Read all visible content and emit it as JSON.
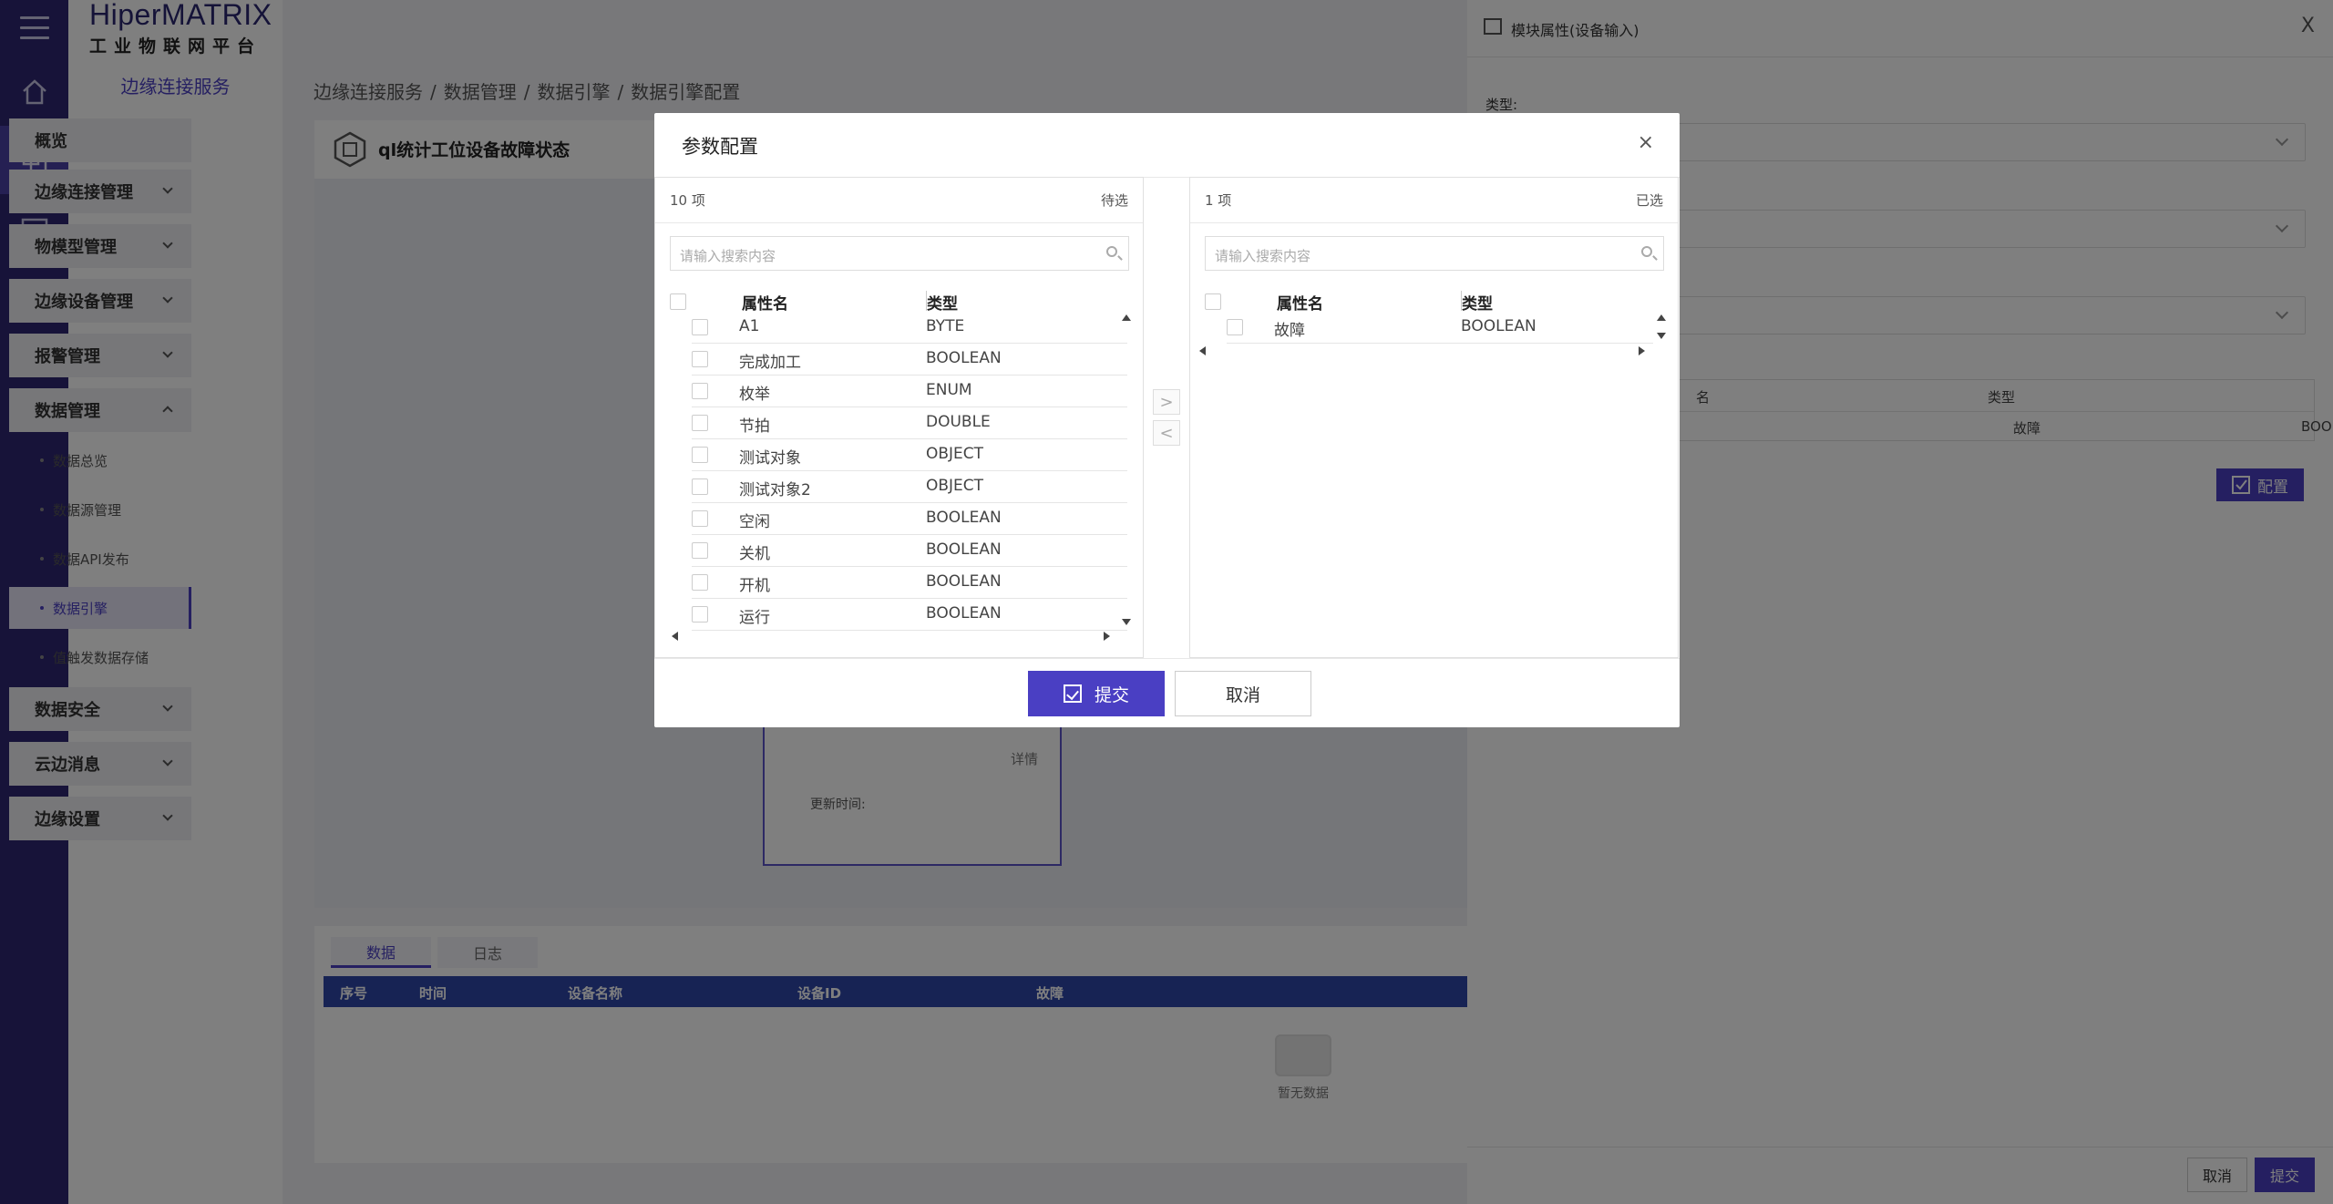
{
  "brand": {
    "logo_main": "HiperMATRIX",
    "logo_sub": "工业物联网平台"
  },
  "sidebar": {
    "title": "边缘连接服务",
    "items": [
      {
        "label": "概览"
      },
      {
        "label": "边缘连接管理"
      },
      {
        "label": "物模型管理"
      },
      {
        "label": "边缘设备管理"
      },
      {
        "label": "报警管理"
      },
      {
        "label": "数据管理"
      },
      {
        "label": "数据安全"
      },
      {
        "label": "云边消息"
      },
      {
        "label": "边缘设置"
      }
    ],
    "sub_items": [
      {
        "label": "数据总览"
      },
      {
        "label": "数据源管理"
      },
      {
        "label": "数据API发布"
      },
      {
        "label": "数据引擎"
      },
      {
        "label": "值触发数据存储"
      }
    ]
  },
  "breadcrumb": [
    "边缘连接服务",
    "/",
    "数据管理",
    "/",
    "数据引擎",
    "/",
    "数据引擎配置"
  ],
  "engine": {
    "title": "ql统计工位设备故障状态"
  },
  "device_card": {
    "detail": "详情",
    "updated_label": "更新时间:"
  },
  "bottom": {
    "tabs": [
      "数据",
      "日志"
    ],
    "columns": [
      "序号",
      "时间",
      "设备名称",
      "设备ID",
      "故障"
    ],
    "empty_text": "暂无数据"
  },
  "drawer": {
    "title": "模块属性(设备输入)",
    "close": "X",
    "type_label": "类型:",
    "table_headers": [
      "名",
      "类型"
    ],
    "table_row": [
      "故障",
      "BOOLEAN"
    ],
    "config_button": "配置",
    "cancel_button": "取消",
    "submit_button": "提交"
  },
  "modal": {
    "title": "参数配置",
    "close": "×",
    "left": {
      "count": "10 项",
      "status": "待选",
      "search_placeholder": "请输入搜索内容",
      "col_name": "属性名",
      "col_type": "类型",
      "rows": [
        {
          "name": "A1",
          "type": "BYTE"
        },
        {
          "name": "完成加工",
          "type": "BOOLEAN"
        },
        {
          "name": "枚举",
          "type": "ENUM"
        },
        {
          "name": "节拍",
          "type": "DOUBLE"
        },
        {
          "name": "测试对象",
          "type": "OBJECT"
        },
        {
          "name": "测试对象2",
          "type": "OBJECT"
        },
        {
          "name": "空闲",
          "type": "BOOLEAN"
        },
        {
          "name": "关机",
          "type": "BOOLEAN"
        },
        {
          "name": "开机",
          "type": "BOOLEAN"
        },
        {
          "name": "运行",
          "type": "BOOLEAN"
        }
      ]
    },
    "right": {
      "count": "1 项",
      "status": "已选",
      "search_placeholder": "请输入搜索内容",
      "col_name": "属性名",
      "col_type": "类型",
      "rows": [
        {
          "name": "故障",
          "type": "BOOLEAN"
        }
      ]
    },
    "move_right": ">",
    "move_left": "<",
    "submit": "提交",
    "cancel": "取消"
  },
  "colors": {
    "primary": "#4a3fc3",
    "rail": "#2e2672",
    "table_header": "#2f46a8"
  }
}
